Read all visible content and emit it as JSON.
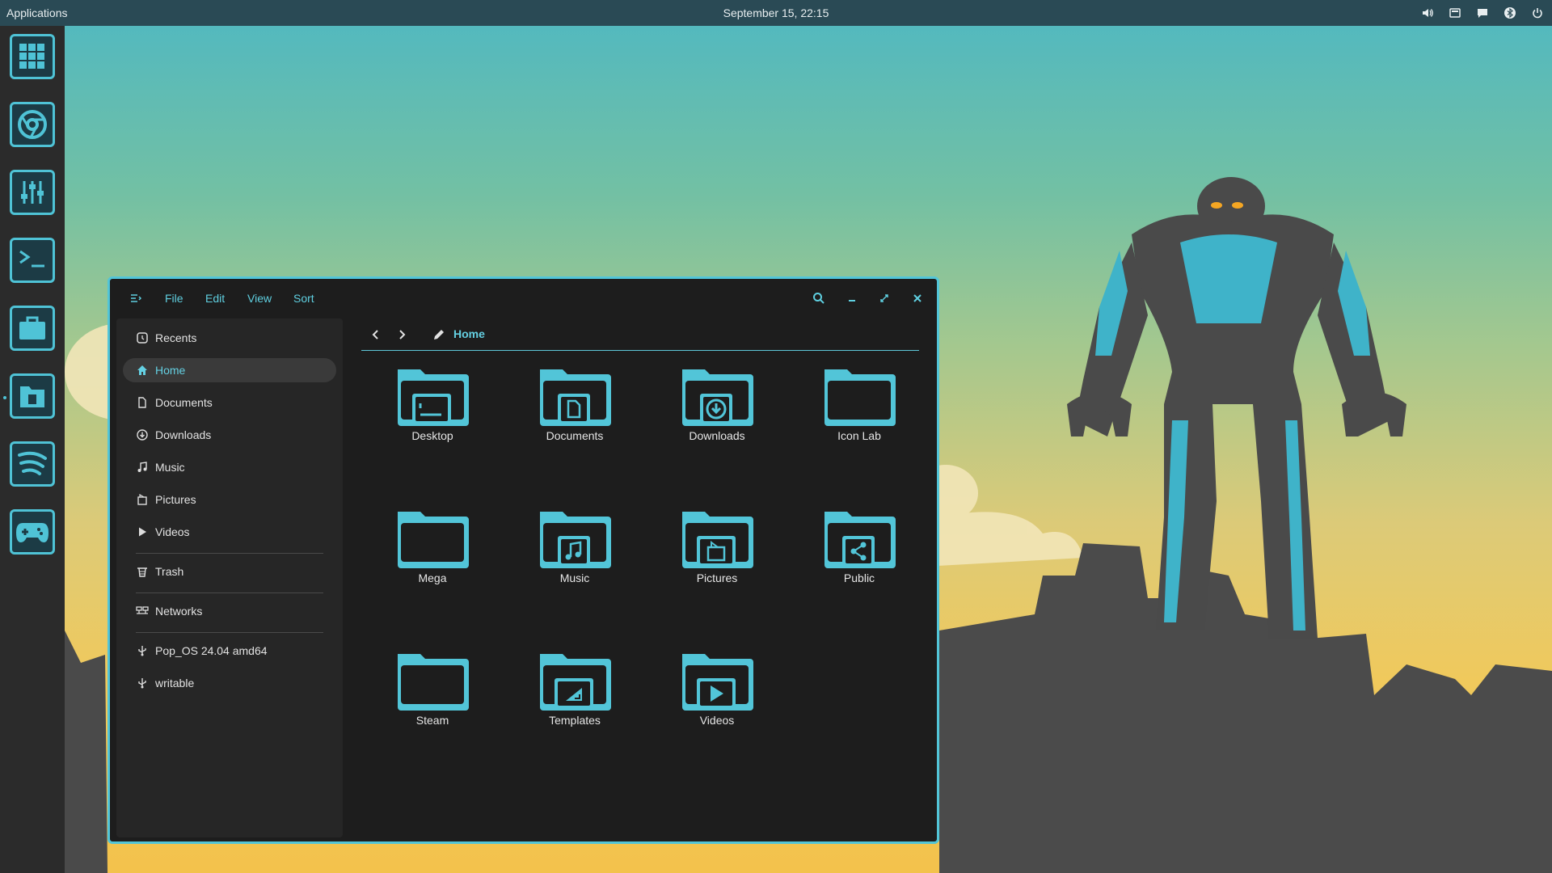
{
  "topbar": {
    "applications_label": "Applications",
    "clock": "September 15, 22:15",
    "tray_icons": [
      "volume-icon",
      "display-icon",
      "chat-icon",
      "bluetooth-icon",
      "power-icon"
    ]
  },
  "dock": {
    "items": [
      {
        "name": "app-grid-icon"
      },
      {
        "name": "chrome-icon"
      },
      {
        "name": "settings-sliders-icon"
      },
      {
        "name": "terminal-icon"
      },
      {
        "name": "briefcase-icon"
      },
      {
        "name": "files-icon",
        "running": true
      },
      {
        "name": "spotify-icon"
      },
      {
        "name": "gamepad-icon"
      }
    ]
  },
  "window": {
    "menu": {
      "file": "File",
      "edit": "Edit",
      "view": "View",
      "sort": "Sort"
    },
    "location": "Home",
    "sidebar": [
      {
        "label": "Recents",
        "icon": "clock-icon"
      },
      {
        "label": "Home",
        "icon": "home-icon",
        "active": true
      },
      {
        "label": "Documents",
        "icon": "document-icon"
      },
      {
        "label": "Downloads",
        "icon": "download-icon"
      },
      {
        "label": "Music",
        "icon": "music-note-icon"
      },
      {
        "label": "Pictures",
        "icon": "picture-icon"
      },
      {
        "label": "Videos",
        "icon": "play-icon"
      },
      {
        "label": "Trash",
        "icon": "trash-icon"
      },
      {
        "label": "Networks",
        "icon": "network-icon"
      },
      {
        "label": "Pop_OS 24.04 amd64",
        "icon": "usb-icon"
      },
      {
        "label": "writable",
        "icon": "usb-icon"
      }
    ],
    "folders": [
      {
        "label": "Desktop",
        "icon": "desktop"
      },
      {
        "label": "Documents",
        "icon": "document"
      },
      {
        "label": "Downloads",
        "icon": "download"
      },
      {
        "label": "Icon Lab",
        "icon": "none"
      },
      {
        "label": "Mega",
        "icon": "none"
      },
      {
        "label": "Music",
        "icon": "music"
      },
      {
        "label": "Pictures",
        "icon": "picture"
      },
      {
        "label": "Public",
        "icon": "share"
      },
      {
        "label": "Steam",
        "icon": "none"
      },
      {
        "label": "Templates",
        "icon": "template"
      },
      {
        "label": "Videos",
        "icon": "video"
      }
    ]
  },
  "colors": {
    "accent": "#52c5d8",
    "window_bg": "#1d1d1d",
    "topbar": "#2a4a55",
    "dock": "#2b2b2b"
  }
}
